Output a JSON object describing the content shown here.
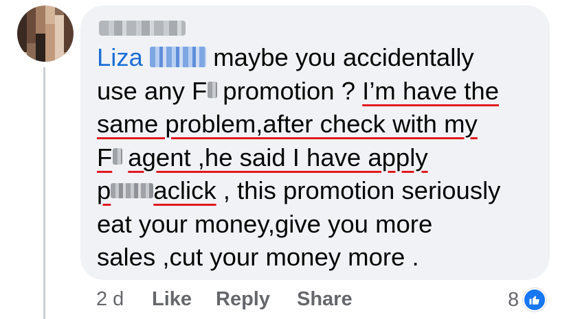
{
  "author": {
    "avatar_alt": "user avatar (pixelated)",
    "name_redacted": true
  },
  "comment": {
    "mention_first": "Liza",
    "line1_text": "maybe you accidentally",
    "line2_pre": "use any F",
    "line2_mid": "promotion ? ",
    "line2_ul": "I’m have the",
    "line3_ul": "same problem,after check with my",
    "line4_ul_a": "F",
    "line4_ul_b": "agent ,he said I have apply",
    "line5_ul_a": "p",
    "line5_ul_b": "aclick",
    "line5_rest": " , this promotion seriously",
    "line6": "eat your money,give you more",
    "line7": "sales ,cut your money more ."
  },
  "actions": {
    "time": "2 d",
    "like": "Like",
    "reply": "Reply",
    "share": "Share"
  },
  "reactions": {
    "count": "8",
    "icon": "thumbs-up-icon",
    "color": "#1877f2"
  },
  "colors": {
    "mention": "#1b6fd6",
    "underline": "#e0191f",
    "bubble": "#f0f2f5"
  }
}
